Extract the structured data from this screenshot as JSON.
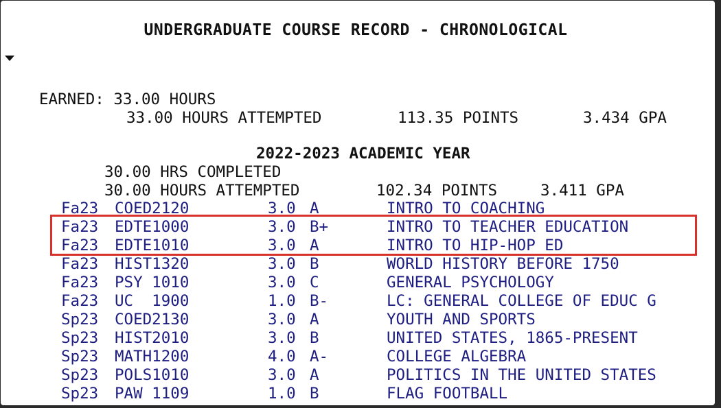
{
  "header": {
    "title": "UNDERGRADUATE COURSE RECORD - CHRONOLOGICAL"
  },
  "icons": {
    "arrow": "triangle-down-icon"
  },
  "summary": {
    "earned_label": "EARNED:",
    "earned_hours": "33.00 HOURS",
    "attempted_hours": "33.00 HOURS ATTEMPTED",
    "points": "113.35 POINTS",
    "gpa": "3.434 GPA"
  },
  "academic_year": {
    "title": "2022-2023 ACADEMIC YEAR",
    "hrs_completed": "30.00 HRS COMPLETED",
    "hours_attempted": "30.00 HOURS ATTEMPTED",
    "points": "102.34 POINTS",
    "gpa": "3.411 GPA"
  },
  "courses": [
    {
      "term": "Fa23",
      "code": "COED2120",
      "credits": "3.0",
      "grade": "A",
      "title": "INTRO TO COACHING"
    },
    {
      "term": "Fa23",
      "code": "EDTE1000",
      "credits": "3.0",
      "grade": "B+",
      "title": "INTRO TO TEACHER EDUCATION"
    },
    {
      "term": "Fa23",
      "code": "EDTE1010",
      "credits": "3.0",
      "grade": "A",
      "title": "INTRO TO HIP-HOP ED"
    },
    {
      "term": "Fa23",
      "code": "HIST1320",
      "credits": "3.0",
      "grade": "B",
      "title": "WORLD HISTORY BEFORE 1750"
    },
    {
      "term": "Fa23",
      "code": "PSY 1010",
      "credits": "3.0",
      "grade": "C",
      "title": "GENERAL PSYCHOLOGY"
    },
    {
      "term": "Fa23",
      "code": "UC  1900",
      "credits": "1.0",
      "grade": "B-",
      "title": "LC: GENERAL COLLEGE OF EDUC G"
    },
    {
      "term": "Sp23",
      "code": "COED2130",
      "credits": "3.0",
      "grade": "A",
      "title": "YOUTH AND SPORTS"
    },
    {
      "term": "Sp23",
      "code": "HIST2010",
      "credits": "3.0",
      "grade": "B",
      "title": "UNITED STATES, 1865-PRESENT"
    },
    {
      "term": "Sp23",
      "code": "MATH1200",
      "credits": "4.0",
      "grade": "A-",
      "title": "COLLEGE ALGEBRA"
    },
    {
      "term": "Sp23",
      "code": "POLS1010",
      "credits": "3.0",
      "grade": "A",
      "title": "POLITICS IN THE UNITED STATES"
    },
    {
      "term": "Sp23",
      "code": "PAW 1109",
      "credits": "1.0",
      "grade": "B",
      "title": "FLAG FOOTBALL"
    }
  ],
  "highlight": {
    "color": "#d9302a"
  }
}
